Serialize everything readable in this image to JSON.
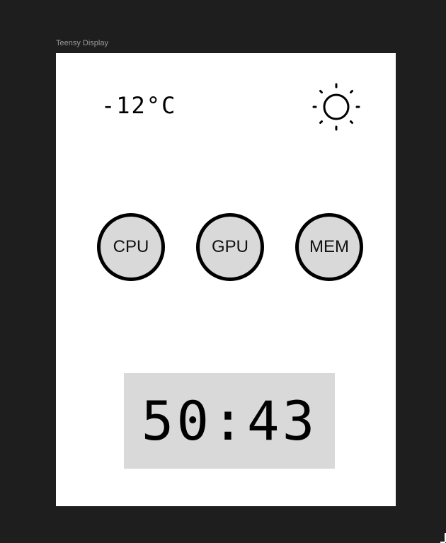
{
  "frame": {
    "label": "Teensy Display"
  },
  "display": {
    "temperature": "-12°C",
    "weather_icon": "sun-icon",
    "gauges": [
      {
        "label": "CPU"
      },
      {
        "label": "GPU"
      },
      {
        "label": "MEM"
      }
    ],
    "clock": "50:43"
  },
  "colors": {
    "canvas_background": "#1e1e1e",
    "frame_background": "#ffffff",
    "gauge_fill": "#d9d9d9",
    "gauge_border": "#000000",
    "clock_background": "#d9d9d9"
  }
}
